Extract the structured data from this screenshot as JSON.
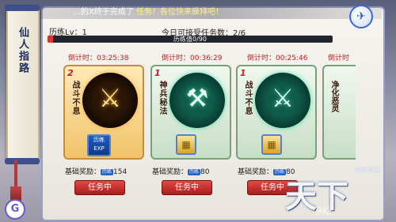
{
  "broadcast": {
    "prefix": "…的X",
    "text_mid": "终于完成了",
    "text_tail": "任务！各位快来膜拜吧！"
  },
  "sidebar": {
    "title": "仙人指路"
  },
  "header": {
    "level_label": "历练Lv：1",
    "accept_info": "今日可接受任务数：2/6",
    "xp_text": "历练值0/90",
    "xp_progress": 0.0
  },
  "cards": [
    {
      "timer": "倒计时：03:25:38",
      "stars": "2",
      "title": "战斗不息",
      "glyph": "⚔",
      "reward_label": "基础奖励：",
      "reward_value": "154",
      "button": "任务中",
      "theme": "gold",
      "reward_icon": "exp-scroll-icon"
    },
    {
      "timer": "倒计时：00:36:29",
      "stars": "1",
      "title": "神兵秘法",
      "glyph": "⚒",
      "reward_label": "基础奖励：",
      "reward_value": "80",
      "button": "任务中",
      "theme": "green",
      "reward_icon": "gold-ingot-icon"
    },
    {
      "timer": "倒计时：00:25:46",
      "stars": "1",
      "title": "战斗不息",
      "glyph": "⚔",
      "reward_label": "基础奖励：",
      "reward_value": "80",
      "button": "任务中",
      "theme": "green",
      "reward_icon": "gold-ingot-icon"
    },
    {
      "timer": "倒计时",
      "title": "净化恶灵"
    }
  ],
  "logo": {
    "text": "天下",
    "small": "暗影迷踪",
    "watermark": "9K"
  },
  "badge": {
    "letter": "G"
  }
}
